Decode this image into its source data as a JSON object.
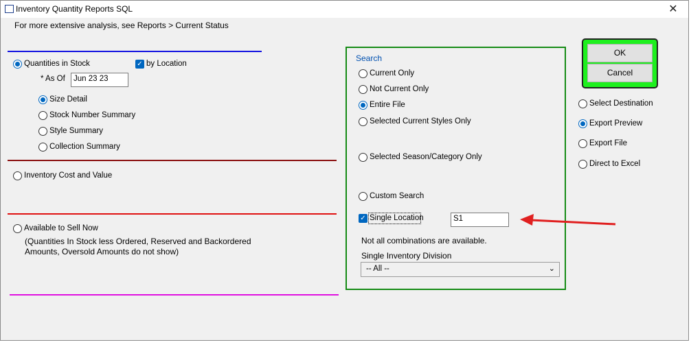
{
  "window": {
    "title": "Inventory Quantity Reports SQL",
    "close_glyph": "✕"
  },
  "hint_text": "For more extensive analysis, see Reports > Current Status",
  "quantities": {
    "label": "Quantities in Stock",
    "checked": true,
    "by_location_label": "by Location",
    "as_of_label": "* As Of",
    "as_of_value": "Jun 23 23",
    "detail_options": [
      {
        "label": "Size Detail",
        "checked": true
      },
      {
        "label": "Stock Number Summary",
        "checked": false
      },
      {
        "label": "Style Summary",
        "checked": false
      },
      {
        "label": "Collection Summary",
        "checked": false
      }
    ]
  },
  "cost": {
    "label": "Inventory Cost and Value"
  },
  "available": {
    "label": "Available to Sell Now",
    "note_line1": "(Quantities In Stock less Ordered, Reserved and Backordered",
    "note_line2": "Amounts, Oversold Amounts do not show)"
  },
  "search": {
    "title": "Search",
    "options": [
      {
        "label": "Current Only",
        "checked": false
      },
      {
        "label": "Not Current Only",
        "checked": false
      },
      {
        "label": "Entire File",
        "checked": true
      },
      {
        "label": "Selected Current Styles Only",
        "checked": false
      },
      {
        "label": "Selected Season/Category Only",
        "checked": false
      },
      {
        "label": "Custom Search",
        "checked": false
      }
    ],
    "single_location_label": "Single Location",
    "single_location_value": "S1",
    "note": "Not all combinations are available.",
    "division_label": "Single Inventory Division",
    "division_value": "-- All --"
  },
  "buttons": {
    "ok": "OK",
    "cancel": "Cancel"
  },
  "destination": {
    "options": [
      {
        "label": "Select Destination",
        "checked": false
      },
      {
        "label": "Export Preview",
        "checked": true
      },
      {
        "label": "Export File",
        "checked": false
      },
      {
        "label": "Direct to Excel",
        "checked": false
      }
    ]
  },
  "colors": {
    "accent": "#0067c0",
    "group_border": "#138a13",
    "ok_highlight": "#1ef01e",
    "arrow": "#e02020",
    "line_blue": "#1010e0",
    "line_maroon": "#8b1010",
    "line_red": "#e01010",
    "line_magenta": "#e010e0"
  },
  "icons": {
    "arrow": "red-pointer-arrow-icon",
    "checkmark": "checkmark-icon",
    "dropdown": "chevron-down-icon"
  }
}
